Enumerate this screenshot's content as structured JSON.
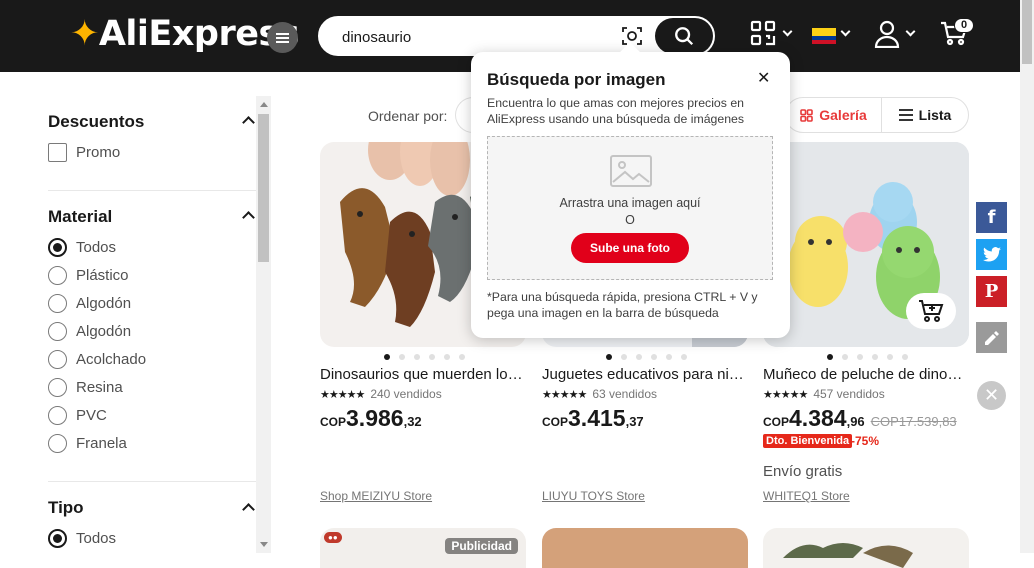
{
  "header": {
    "logo_text": "AliExpress",
    "search_value": "dinosaurio",
    "cart_count": "0"
  },
  "toolbar": {
    "sort_label": "Ordenar por:",
    "view_gallery": "Galería",
    "view_list": "Lista"
  },
  "filters": {
    "discounts": {
      "title": "Descuentos",
      "options": [
        "Promo"
      ]
    },
    "material": {
      "title": "Material",
      "options": [
        "Todos",
        "Plástico",
        "Algodón",
        "Algodón",
        "Acolchado",
        "Resina",
        "PVC",
        "Franela"
      ],
      "selected": "Todos"
    },
    "tipo": {
      "title": "Tipo",
      "options": [
        "Todos"
      ],
      "selected": "Todos"
    }
  },
  "products": [
    {
      "title": "Dinosaurios que muerden los dedos",
      "stars": "★★★★★",
      "sold": "240 vendidos",
      "currency": "COP",
      "price_int": "3.986",
      "price_dec": ",32",
      "store": "Shop MEIZIYU Store"
    },
    {
      "title": "Juguetes educativos para niños dinosaurio",
      "stars": "★★★★★",
      "sold": "63 vendidos",
      "currency": "COP",
      "price_int": "3.415",
      "price_dec": ",37",
      "store": "LIUYU TOYS Store"
    },
    {
      "title": "Muñeco de peluche de dinosaurio",
      "stars": "★★★★★",
      "sold": "457 vendidos",
      "currency": "COP",
      "price_int": "4.384",
      "price_dec": ",96",
      "old_price": "COP17.539,83",
      "badge": "Dto. Bienvenida",
      "discount": "-75%",
      "shipping": "Envío gratis",
      "store": "WHITEQ1 Store"
    }
  ],
  "row2": {
    "ad_label": "Publicidad"
  },
  "popup": {
    "title": "Búsqueda por imagen",
    "description": "Encuentra lo que amas con mejores precios en AliExpress usando una búsqueda de imágenes",
    "drop_text": "Arrastra una imagen aquí",
    "or_text": "O",
    "upload_button": "Sube una foto",
    "hint": "*Para una búsqueda rápida, presiona CTRL + V y pega una imagen en la barra de búsqueda"
  },
  "social": [
    "facebook-icon",
    "twitter-icon",
    "pinterest-icon",
    "edit-icon"
  ],
  "colors": {
    "header_bg": "#191919",
    "accent_red": "#e1001a",
    "gallery_red": "#e83a3a",
    "facebook": "#3b5998",
    "twitter": "#1da1f2",
    "pinterest": "#cb2027"
  }
}
